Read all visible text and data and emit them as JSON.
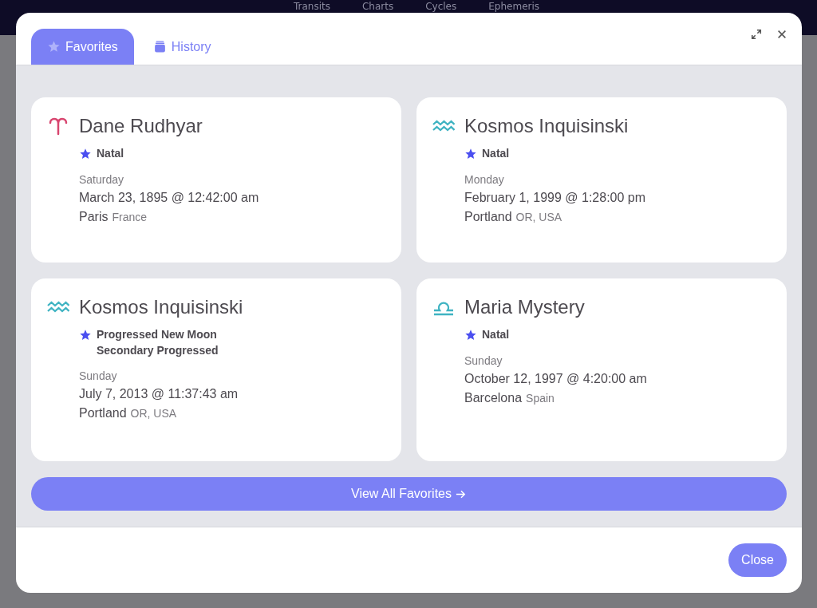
{
  "nav": [
    "Transits",
    "Charts",
    "Cycles",
    "Ephemeris"
  ],
  "tabs": [
    {
      "label": "Favorites",
      "selected": true
    },
    {
      "label": "History",
      "selected": false
    }
  ],
  "favorites": [
    {
      "kind": "aries",
      "name": "Dane Rudhyar",
      "chart_types": [
        "Natal"
      ],
      "weekday": "Saturday",
      "datetime": "March 23, 1895 @ 12:42:00 am",
      "city": "Paris",
      "region": "France"
    },
    {
      "kind": "aquarius",
      "name": "Kosmos Inquisinski",
      "chart_types": [
        "Natal"
      ],
      "weekday": "Monday",
      "datetime": "February 1, 1999 @ 1:28:00 pm",
      "city": "Portland",
      "region": "OR, USA"
    },
    {
      "kind": "aquarius",
      "name": "Kosmos Inquisinski",
      "chart_types": [
        "Progressed New Moon",
        "Secondary Progressed"
      ],
      "weekday": "Sunday",
      "datetime": "July 7, 2013 @ 11:37:43 am",
      "city": "Portland",
      "region": "OR, USA"
    },
    {
      "kind": "libra",
      "name": "Maria Mystery",
      "chart_types": [
        "Natal"
      ],
      "weekday": "Sunday",
      "datetime": "October 12, 1997 @ 4:20:00 am",
      "city": "Barcelona",
      "region": "Spain"
    }
  ],
  "view_all_button": "View All Favorites",
  "close_button": "Close"
}
